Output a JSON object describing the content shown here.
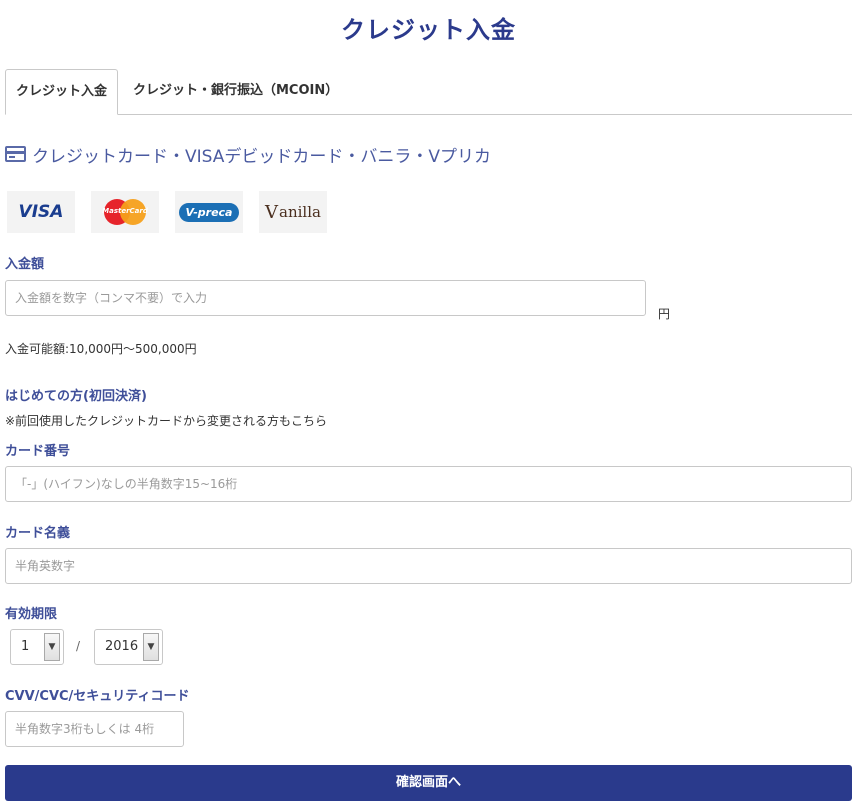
{
  "page": {
    "title": "クレジット入金"
  },
  "tabs": [
    {
      "label": "クレジット入金"
    },
    {
      "label": "クレジット・銀行振込（MCOIN）"
    }
  ],
  "section": {
    "heading": "クレジットカード・VISAデビッドカード・バニラ・Vプリカ"
  },
  "logos": {
    "visa": "VISA",
    "mastercard": "MasterCard",
    "vpreca": "V-preca",
    "vanilla": "anilla"
  },
  "amount": {
    "label": "入金額",
    "placeholder": "入金額を数字（コンマ不要）で入力",
    "unit": "円",
    "range_note": "入金可能額:10,000円～500,000円"
  },
  "first_time": {
    "heading": "はじめての方(初回決済)",
    "note": "※前回使用したクレジットカードから変更される方もこちら"
  },
  "card_number": {
    "label": "カード番号",
    "placeholder": "「-」(ハイフン)なしの半角数字15~16桁"
  },
  "card_name": {
    "label": "カード名義",
    "placeholder": "半角英数字"
  },
  "expiry": {
    "label": "有効期限",
    "month": "1",
    "separator": "/",
    "year": "2016"
  },
  "cvv": {
    "label": "CVV/CVC/セキュリティコード",
    "placeholder": "半角数字3桁もしくは 4桁"
  },
  "submit": {
    "label": "確認画面へ"
  },
  "colors": {
    "primary": "#2a3a8c",
    "label": "#3f4f99",
    "border": "#c8c8c8"
  }
}
